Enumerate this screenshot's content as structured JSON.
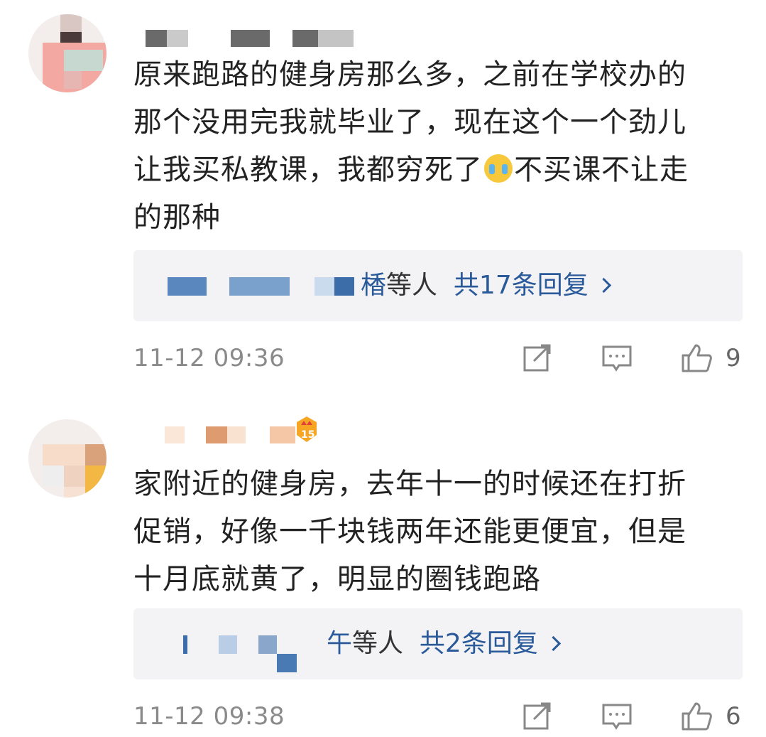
{
  "comments": [
    {
      "text_lines": [
        "原来跑路的健身房那么多，之前在学校办的",
        "那个没用完我就毕业了，现在这个一个劲儿",
        "让我买私教课，我都穷死了",
        "的那种"
      ],
      "text_line3_after_emoji": "不买课不让走",
      "emoji": "crying-emoji",
      "reply_partial_name": "楿",
      "reply_suffix": "等人",
      "reply_count_label": "共17条回复",
      "timestamp": "11-12 09:36",
      "like_count": "9"
    },
    {
      "text_lines": [
        "家附近的健身房，去年十一的时候还在打折",
        "促销，好像一千块钱两年还能更便宜，但是",
        "十月底就黄了，明显的圈钱跑路"
      ],
      "badge_icon": "vip-badge-icon",
      "reply_partial_name": "午",
      "reply_suffix": "等人",
      "reply_count_label": "共2条回复",
      "timestamp": "11-12 09:38",
      "like_count": "6"
    }
  ],
  "icons": {
    "share": "share-icon",
    "comment": "comment-icon",
    "like": "thumbs-up-icon"
  },
  "colors": {
    "text": "#222222",
    "link": "#2a5a9a",
    "meta": "#8a8a8a",
    "reply_bg": "#f3f3f5"
  }
}
